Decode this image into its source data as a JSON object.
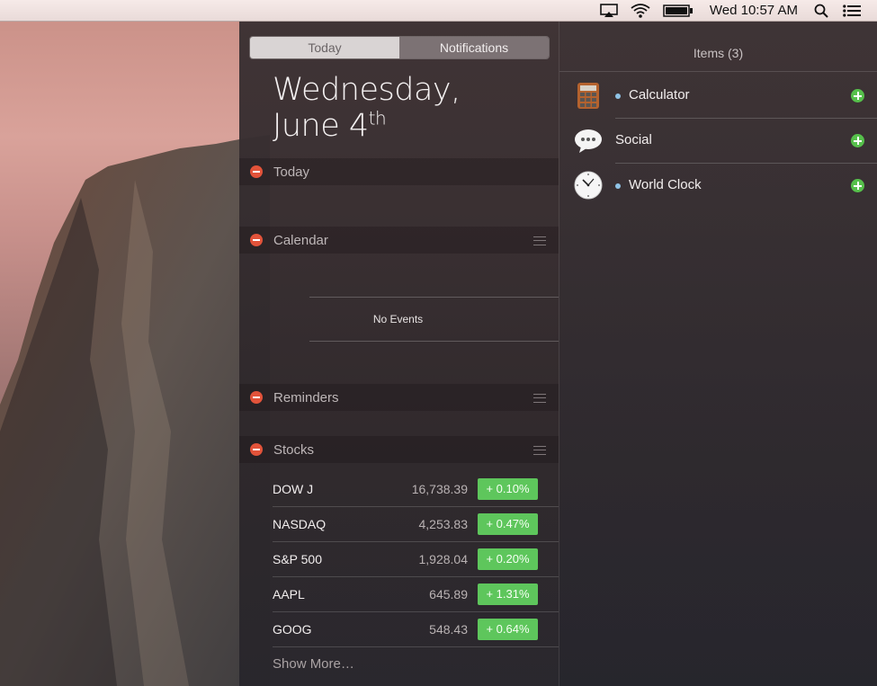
{
  "menubar": {
    "clock": "Wed 10:57 AM",
    "icons": [
      "airplay-icon",
      "wifi-icon",
      "battery-icon",
      "spotlight-search-icon",
      "notification-center-icon"
    ]
  },
  "tabs": {
    "today": "Today",
    "notifications": "Notifications"
  },
  "date": {
    "line1": "Wednesday,",
    "line2": "June 4",
    "suffix": "th"
  },
  "sections": {
    "today": "Today",
    "calendar": "Calendar",
    "calendar_empty": "No Events",
    "reminders": "Reminders",
    "stocks": "Stocks"
  },
  "stocks": [
    {
      "name": "DOW J",
      "price": "16,738.39",
      "change": "+ 0.10%"
    },
    {
      "name": "NASDAQ",
      "price": "4,253.83",
      "change": "+ 0.47%"
    },
    {
      "name": "S&P 500",
      "price": "1,928.04",
      "change": "+ 0.20%"
    },
    {
      "name": "AAPL",
      "price": "645.89",
      "change": "+ 1.31%"
    },
    {
      "name": "GOOG",
      "price": "548.43",
      "change": "+ 0.64%"
    }
  ],
  "show_more": "Show More…",
  "items_panel": {
    "title": "Items (3)",
    "items": [
      {
        "label": "Calculator",
        "icon": "calculator-icon",
        "dot": true
      },
      {
        "label": "Social",
        "icon": "speech-bubble-icon",
        "dot": false
      },
      {
        "label": "World Clock",
        "icon": "clock-icon",
        "dot": true
      }
    ]
  },
  "colors": {
    "gain": "#5ec65c",
    "remove": "#e2533a",
    "add": "#56c04b"
  }
}
